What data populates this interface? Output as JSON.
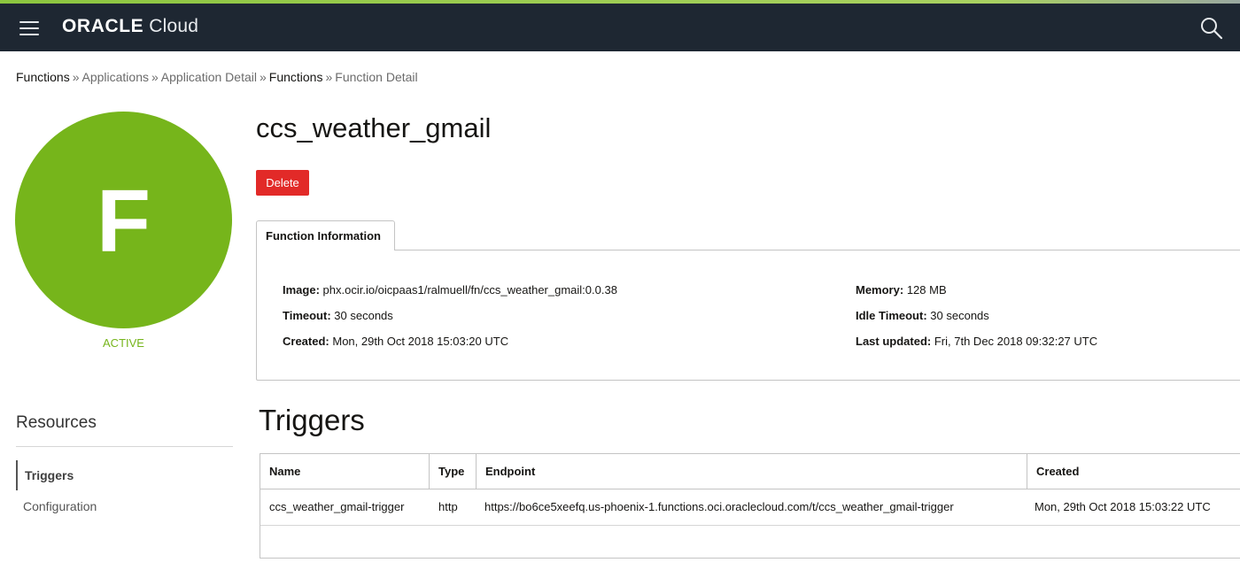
{
  "colors": {
    "topbar": "#1e2732",
    "accent_strip": "#8cc63f",
    "avatar": "#76b51b",
    "status": "#76b51b",
    "danger": "#e22a28"
  },
  "header": {
    "brand_oracle": "ORACLE",
    "brand_cloud": "Cloud",
    "menu_icon": "hamburger-icon",
    "search_icon": "search-icon"
  },
  "breadcrumb": [
    {
      "label": "Functions"
    },
    {
      "label": "Applications"
    },
    {
      "label": "Application Detail"
    },
    {
      "label": "Functions"
    },
    {
      "label": "Function Detail"
    }
  ],
  "breadcrumb_separator": "»",
  "function": {
    "avatar_letter": "F",
    "status": "ACTIVE",
    "name": "ccs_weather_gmail",
    "delete_label": "Delete"
  },
  "info": {
    "tab_label": "Function Information",
    "image_label": "Image:",
    "image_value": "phx.ocir.io/oicpaas1/ralmuell/fn/ccs_weather_gmail:0.0.38",
    "timeout_label": "Timeout:",
    "timeout_value": "30 seconds",
    "created_label": "Created:",
    "created_value": "Mon, 29th Oct 2018 15:03:20 UTC",
    "memory_label": "Memory:",
    "memory_value": "128 MB",
    "idle_timeout_label": "Idle Timeout:",
    "idle_timeout_value": "30 seconds",
    "last_updated_label": "Last updated:",
    "last_updated_value": "Fri, 7th Dec 2018 09:32:27 UTC"
  },
  "resources": {
    "title": "Resources",
    "items": [
      {
        "label": "Triggers"
      },
      {
        "label": "Configuration"
      }
    ]
  },
  "triggers": {
    "title": "Triggers",
    "columns": [
      "Name",
      "Type",
      "Endpoint",
      "Created"
    ],
    "rows": [
      {
        "name": "ccs_weather_gmail-trigger",
        "type": "http",
        "endpoint": "https://bo6ce5xeefq.us-phoenix-1.functions.oci.oraclecloud.com/t/ccs_weather_gmail-trigger",
        "created": "Mon, 29th Oct 2018 15:03:22 UTC"
      }
    ]
  }
}
